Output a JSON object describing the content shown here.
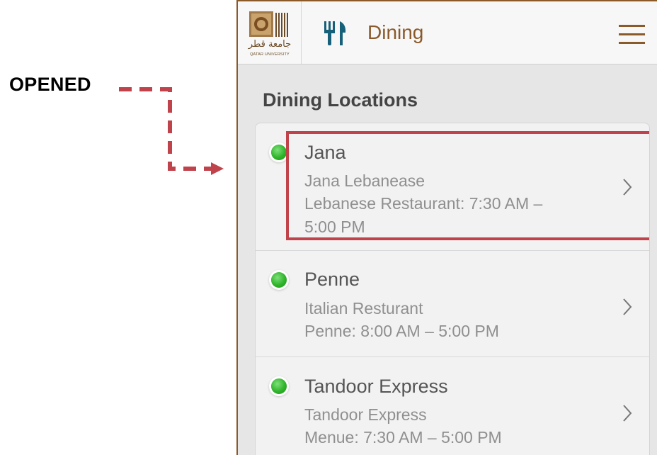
{
  "annotation": {
    "label": "OPENED",
    "color": "#c0434b"
  },
  "header": {
    "logo": {
      "arabic_text": "جامعة قطر",
      "english_text": "QATAR UNIVERSITY"
    },
    "section_icon": "fork-knife-icon",
    "title": "Dining",
    "menu_icon": "hamburger-menu-icon",
    "accent_color": "#8a5a2b",
    "icon_color": "#17607a"
  },
  "main": {
    "section_title": "Dining Locations",
    "locations": [
      {
        "name": "Jana",
        "line1": "Jana Lebanease",
        "line2": "Lebanese Restaurant: 7:30 AM –",
        "line3": "5:00 PM",
        "status": "open",
        "status_color": "#2fb42a",
        "highlighted": true
      },
      {
        "name": "Penne",
        "line1": "Italian Resturant",
        "line2": "Penne: 8:00 AM – 5:00 PM",
        "status": "open",
        "status_color": "#2fb42a"
      },
      {
        "name": "Tandoor Express",
        "line1": "Tandoor Express",
        "line2": "Menue: 7:30 AM – 5:00 PM",
        "status": "open",
        "status_color": "#2fb42a"
      }
    ]
  }
}
